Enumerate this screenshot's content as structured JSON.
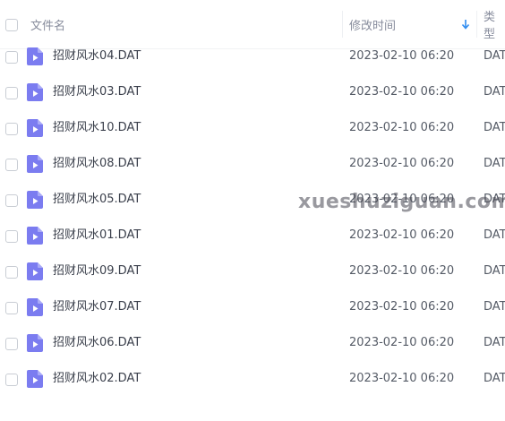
{
  "header": {
    "name_label": "文件名",
    "modified_label": "修改时间",
    "type_label": "类型"
  },
  "files": [
    {
      "name": "招财风水04.DAT",
      "modified": "2023-02-10 06:20",
      "type": "DAT"
    },
    {
      "name": "招财风水03.DAT",
      "modified": "2023-02-10 06:20",
      "type": "DAT"
    },
    {
      "name": "招财风水10.DAT",
      "modified": "2023-02-10 06:20",
      "type": "DAT"
    },
    {
      "name": "招财风水08.DAT",
      "modified": "2023-02-10 06:20",
      "type": "DAT"
    },
    {
      "name": "招财风水05.DAT",
      "modified": "2023-02-10 06:20",
      "type": "DAT"
    },
    {
      "name": "招财风水01.DAT",
      "modified": "2023-02-10 06:20",
      "type": "DAT"
    },
    {
      "name": "招财风水09.DAT",
      "modified": "2023-02-10 06:20",
      "type": "DAT"
    },
    {
      "name": "招财风水07.DAT",
      "modified": "2023-02-10 06:20",
      "type": "DAT"
    },
    {
      "name": "招财风水06.DAT",
      "modified": "2023-02-10 06:20",
      "type": "DAT"
    },
    {
      "name": "招财风水02.DAT",
      "modified": "2023-02-10 06:20",
      "type": "DAT"
    }
  ],
  "watermark": "xueshuziguan.com",
  "icons": {
    "file": "video-file-icon",
    "sort": "sort-descending-icon"
  },
  "colors": {
    "file_icon": "#7b7cf0",
    "sort_arrow": "#2f8cf0"
  }
}
